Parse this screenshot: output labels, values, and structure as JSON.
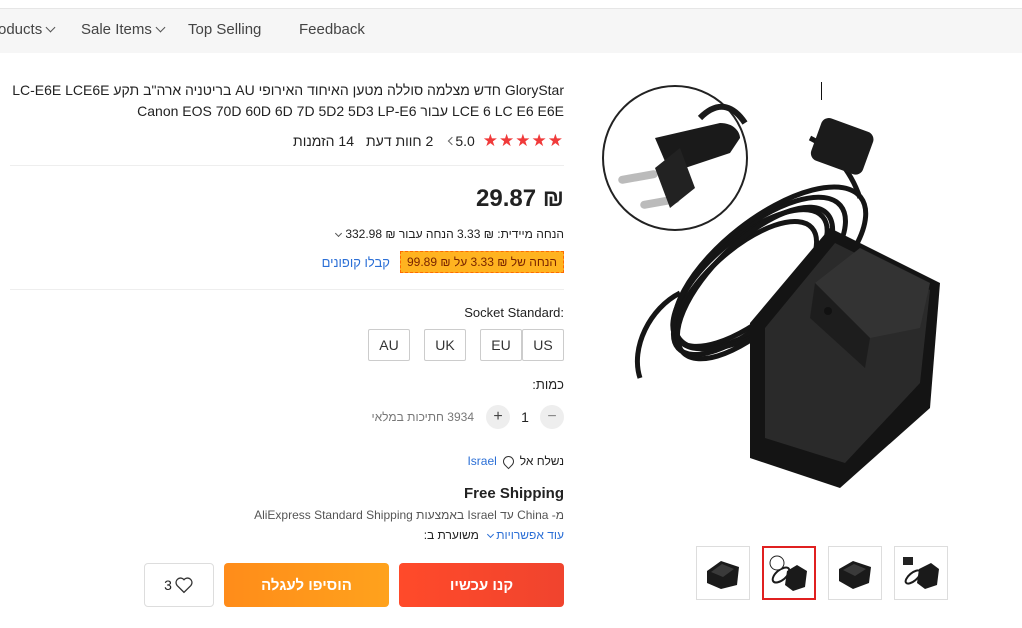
{
  "nav": {
    "items": [
      {
        "label": "oducts",
        "has_dropdown": true
      },
      {
        "label": "Sale Items",
        "has_dropdown": true
      },
      {
        "label": "Top Selling",
        "has_dropdown": false
      },
      {
        "label": "Feedback",
        "has_dropdown": false
      }
    ]
  },
  "product": {
    "title": "GloryStar חדש מצלמה סוללה מטען האיחוד האירופי AU בריטניה ארה\"ב תקע LC-E6E LCE6E LCE 6 LC E6 E6E עבור Canon EOS 70D 60D 6D 7D 5D2 5D3 LP-E6",
    "rating": "5.0",
    "stars": "★★★★★",
    "reviews": "2 חוות דעת",
    "orders": "14 הזמנות",
    "price": "₪ 29.87",
    "instant_discount": "הנחה מיידית: ₪ 3.33 הנחה עבור ₪ 332.98",
    "coupon_badge": "הנחה של ₪ 3.33 על ₪ 99.89",
    "coupon_link": "קבלו קופונים"
  },
  "socket": {
    "label": "Socket Standard:",
    "options": [
      "US",
      "EU",
      "UK",
      "AU"
    ]
  },
  "quantity": {
    "label": "כמות:",
    "value": "1",
    "minus": "−",
    "plus": "+",
    "stock": "3934 חתיכות במלאי"
  },
  "shipping": {
    "ship_to_label": "נשלח אל",
    "country": "Israel",
    "free_shipping": "Free Shipping",
    "method": "מ- China עד Israel באמצעות AliExpress Standard Shipping",
    "more_options": "עוד אפשרויות",
    "estimate_prefix": "משוערת ב:"
  },
  "actions": {
    "buy_now": "קנו עכשיו",
    "add_to_cart": "הוסיפו לעגלה",
    "wishlist_count": "3"
  },
  "colors": {
    "accent_red": "#f0442e",
    "accent_orange": "#ff9a1c",
    "link_blue": "#2b6fd6",
    "star_red": "#f03a3a"
  }
}
